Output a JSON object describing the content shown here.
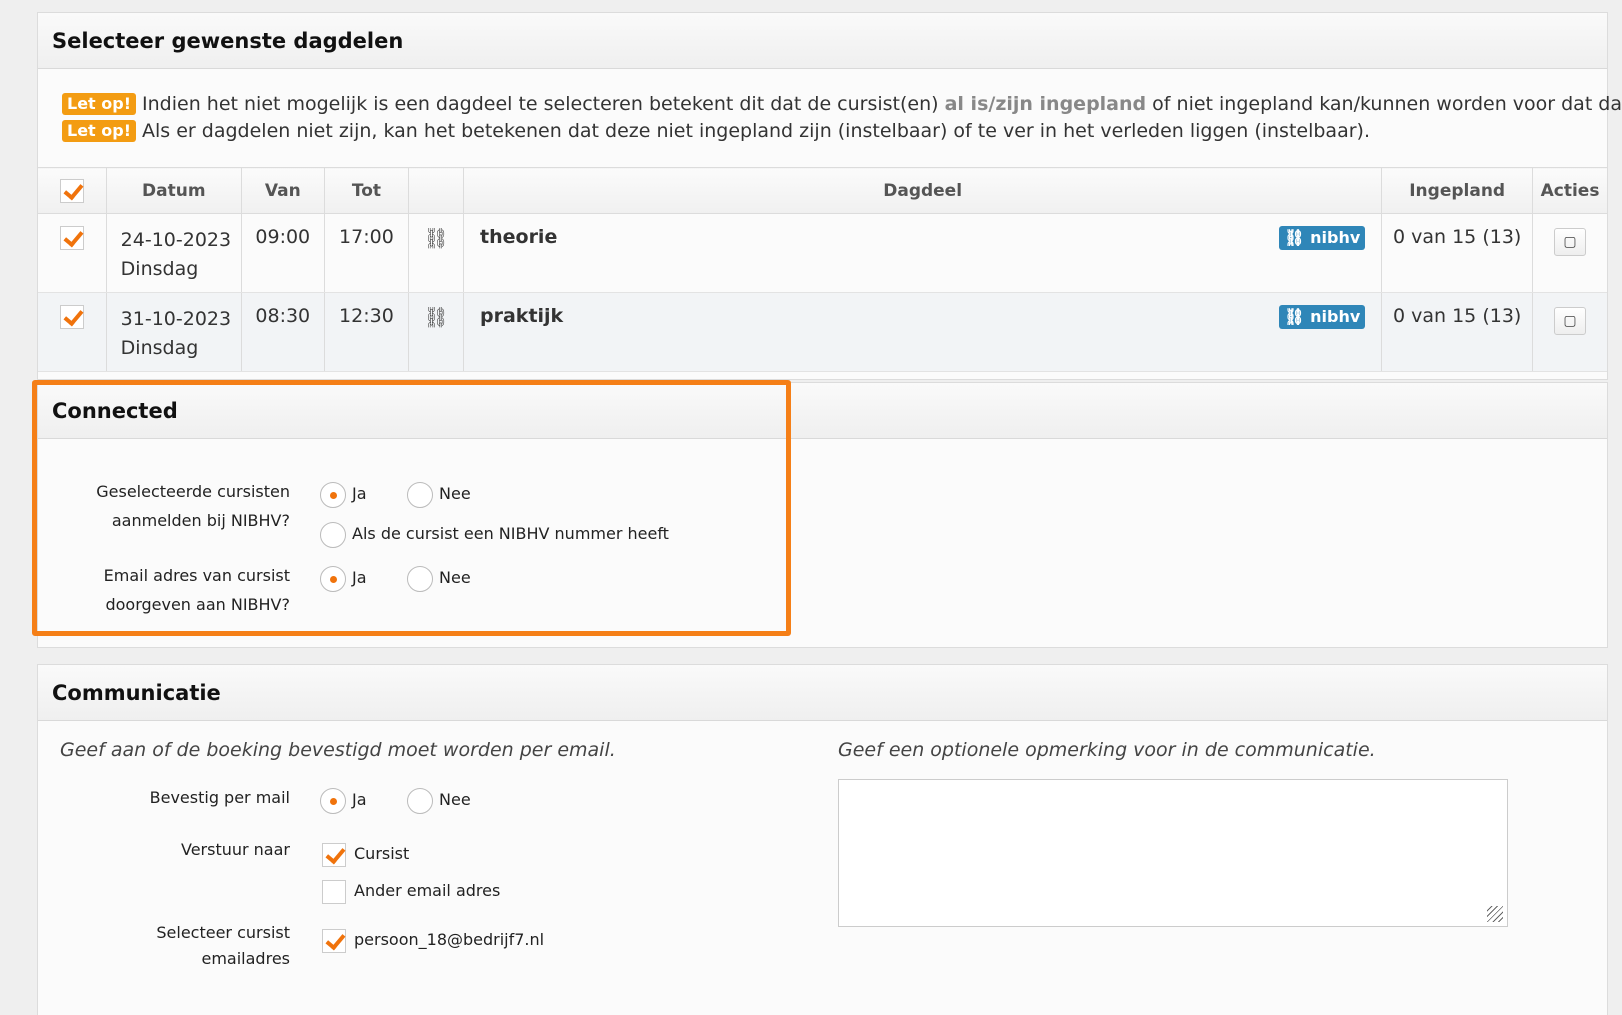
{
  "dagdelen": {
    "title": "Selecteer gewenste dagdelen",
    "notes": [
      {
        "badge": "Let op!",
        "text_before": "Indien het niet mogelijk is een dagdeel te selecteren betekent dit dat de cursist(en) ",
        "link": "al is/zijn ingepland",
        "text_after": " of niet ingepland kan/kunnen worden voor dat dagdeel."
      },
      {
        "badge": "Let op!",
        "text_before": "Als er dagdelen niet zijn, kan het betekenen dat deze niet ingepland zijn (instelbaar) of te ver in het verleden liggen (instelbaar).",
        "link": "",
        "text_after": ""
      }
    ],
    "columns": {
      "datum": "Datum",
      "van": "Van",
      "tot": "Tot",
      "dagdeel": "Dagdeel",
      "ingepland": "Ingepland",
      "acties": "Acties"
    },
    "rows": [
      {
        "date": "24-10-2023",
        "day": "Dinsdag",
        "van": "09:00",
        "tot": "17:00",
        "dagdeel": "theorie",
        "badge": "nibhv",
        "ingepland": "0 van 15 (13)",
        "checked": true
      },
      {
        "date": "31-10-2023",
        "day": "Dinsdag",
        "van": "08:30",
        "tot": "12:30",
        "dagdeel": "praktijk",
        "badge": "nibhv",
        "ingepland": "0 van 15 (13)",
        "checked": true
      }
    ]
  },
  "connected": {
    "title": "Connected",
    "q1_label_1": "Geselecteerde cursisten",
    "q1_label_2": "aanmelden bij NIBHV?",
    "q1_yes": "Ja",
    "q1_no": "Nee",
    "q1_cond": "Als de cursist een NIBHV nummer heeft",
    "q2_label_1": "Email adres van cursist",
    "q2_label_2": "doorgeven aan NIBHV?",
    "q2_yes": "Ja",
    "q2_no": "Nee"
  },
  "communicatie": {
    "title": "Communicatie",
    "hint_left": "Geef aan of de boeking bevestigd moet worden per email.",
    "hint_right": "Geef een optionele opmerking voor in de communicatie.",
    "bevestig_label": "Bevestig per mail",
    "bevestig_yes": "Ja",
    "bevestig_no": "Nee",
    "verstuur_label": "Verstuur naar",
    "verstuur_cursist": "Cursist",
    "verstuur_ander": "Ander email adres",
    "select_label_1": "Selecteer cursist",
    "select_label_2": "emailadres",
    "email": "persoon_18@bedrijf7.nl"
  },
  "icons": {
    "link": "link-icon",
    "note": "note-icon"
  },
  "colors": {
    "accent": "#f0730c",
    "badge_blue": "#2f86b8",
    "badge_orange": "#f39c12",
    "highlight": "#f57f17"
  }
}
